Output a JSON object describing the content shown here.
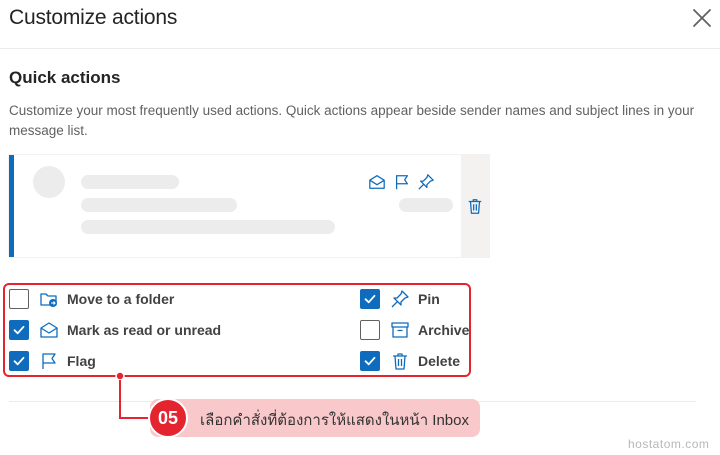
{
  "dialog": {
    "title": "Customize actions",
    "close_icon": "close-icon"
  },
  "quick_actions": {
    "heading": "Quick actions",
    "description": "Customize your most frequently used actions. Quick actions appear beside sender names and subject lines in your message list."
  },
  "preview": {
    "hover_icons": [
      "envelope-open-icon",
      "flag-icon",
      "pin-icon"
    ],
    "side_icon": "trash-icon"
  },
  "options": [
    {
      "id": "move",
      "label": "Move to a folder",
      "icon": "folder-move-icon",
      "checked": false
    },
    {
      "id": "read",
      "label": "Mark as read or unread",
      "icon": "envelope-open-icon",
      "checked": true
    },
    {
      "id": "flag",
      "label": "Flag",
      "icon": "flag-icon",
      "checked": true
    },
    {
      "id": "pin",
      "label": "Pin",
      "icon": "pin-icon",
      "checked": true
    },
    {
      "id": "archive",
      "label": "Archive",
      "icon": "archive-icon",
      "checked": false
    },
    {
      "id": "delete",
      "label": "Delete",
      "icon": "trash-icon",
      "checked": true
    }
  ],
  "callout": {
    "number": "05",
    "text": "เลือกคำสั่งที่ต้องการให้แสดงในหน้า Inbox"
  },
  "watermark": "hostatom.com",
  "colors": {
    "accent": "#0f6cbd",
    "highlight": "#e4252f",
    "callout_bg": "#f9c8cb"
  }
}
